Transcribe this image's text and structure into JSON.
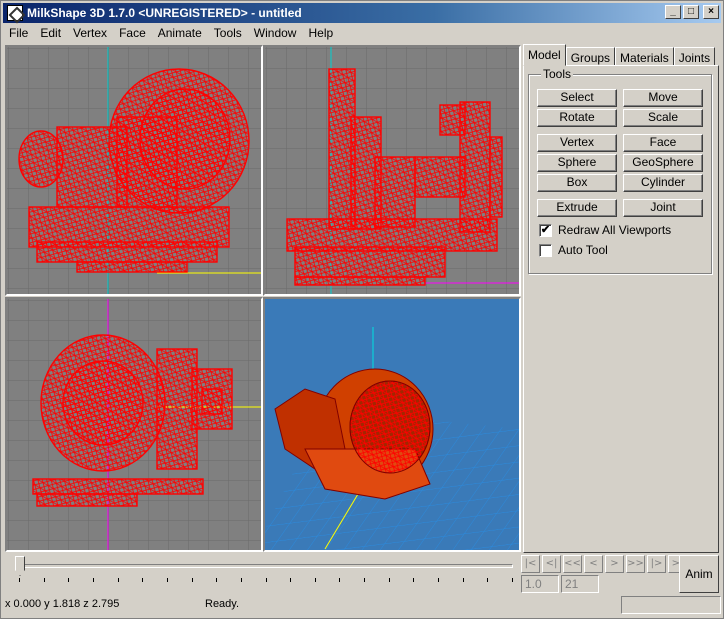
{
  "window": {
    "title": "MilkShape 3D 1.7.0 <UNREGISTERED> - untitled",
    "minimize": "_",
    "maximize": "□",
    "close": "×"
  },
  "menu": [
    "File",
    "Edit",
    "Vertex",
    "Face",
    "Animate",
    "Tools",
    "Window",
    "Help"
  ],
  "tabs": [
    "Model",
    "Groups",
    "Materials",
    "Joints"
  ],
  "active_tab": "Model",
  "tools": {
    "group_label": "Tools",
    "buttons": [
      "Select",
      "Move",
      "Rotate",
      "Scale",
      "Vertex",
      "Face",
      "Sphere",
      "GeoSphere",
      "Box",
      "Cylinder",
      "Extrude",
      "Joint"
    ],
    "redraw_all_viewports": {
      "label": "Redraw All Viewports",
      "checked": true,
      "mark": "✔"
    },
    "auto_tool": {
      "label": "Auto Tool",
      "checked": false,
      "mark": ""
    }
  },
  "animation": {
    "controls": [
      "|<",
      "<|",
      "<<",
      "<",
      ">",
      ">>",
      "|>",
      ">|"
    ],
    "start_frame": "1.0",
    "end_frame": "21",
    "anim_button": "Anim"
  },
  "status": {
    "coords": "x 0.000 y 1.818 z 2.795",
    "message": "Ready."
  },
  "colors": {
    "viewport_bg": "#808080",
    "viewport_3d_bg": "#3a7ab8",
    "wireframe": "#ff0000",
    "grid": "#6a6a6a",
    "grid_3d": "#2a8ce0"
  }
}
